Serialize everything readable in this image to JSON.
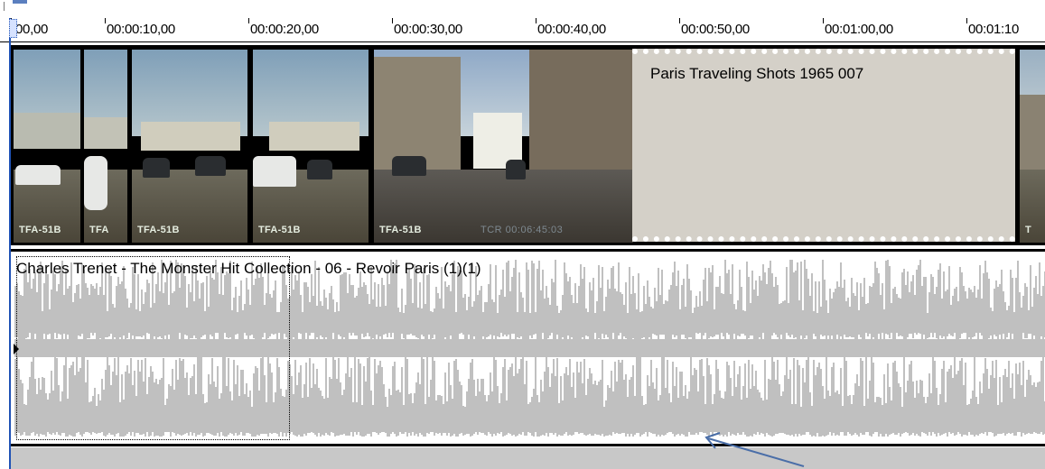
{
  "ruler": {
    "labels": [
      "00,00",
      "00:00:10,00",
      "00:00:20,00",
      "00:00:30,00",
      "00:00:40,00",
      "00:00:50,00",
      "00:01:00,00",
      "00:01:10"
    ],
    "playhead_digit": "0"
  },
  "video_track": {
    "clips": [
      {
        "tag": "TFA-51B"
      },
      {
        "tag": "TFA"
      },
      {
        "tag": "TFA-51B"
      },
      {
        "tag": "TFA-51B"
      },
      {
        "tag": "TFA-51B",
        "timecode": "TCR 00:06:45:03"
      }
    ],
    "placeholder_title": "Paris Traveling Shots 1965 007",
    "edge_tag": "T"
  },
  "audio_track": {
    "title": "Charles Trenet - The Monster Hit Collection - 06 - Revoir Paris (1)(1)"
  },
  "colors": {
    "cursor": "#1f52b5",
    "waveform": "#c0c0c0",
    "placeholder": "#d4d0c8",
    "annotation_arrow": "#4a6ea8"
  },
  "icons": {
    "audio_marker": "play-triangle-icon",
    "annotation": "arrow-pointer-icon"
  }
}
